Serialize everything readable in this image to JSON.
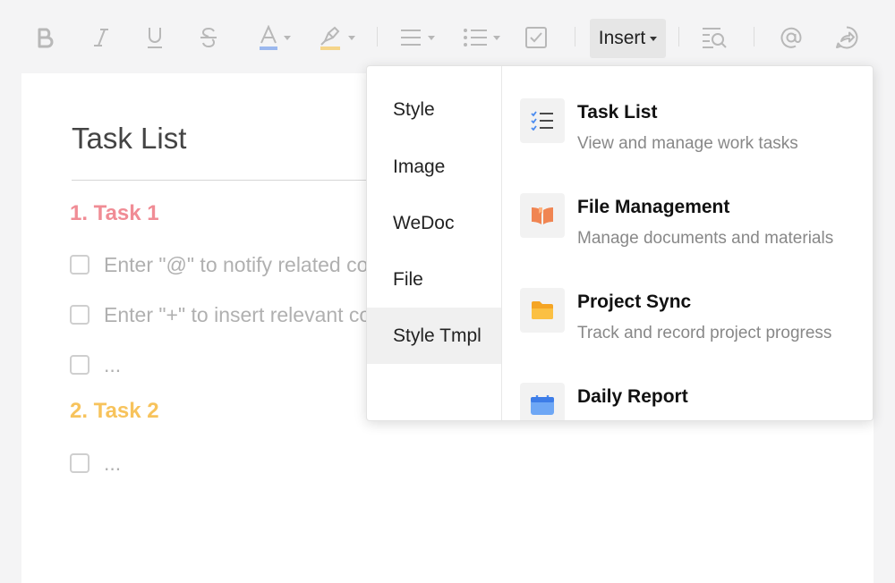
{
  "toolbar": {
    "insert_label": "Insert",
    "icons": [
      "bold-icon",
      "italic-icon",
      "underline-icon",
      "strikethrough-icon",
      "font-color-icon",
      "highlight-icon",
      "align-icon",
      "bullet-list-icon",
      "checkbox-icon",
      "find-replace-icon",
      "mention-icon",
      "share-icon"
    ],
    "font_color_accent": "#9bb8ee",
    "highlight_accent": "#f5d58a"
  },
  "document": {
    "title": "Task List",
    "sections": [
      {
        "heading": "1. Task 1",
        "color": "#f08c95",
        "items": [
          "Enter \"@\" to notify related colleagues",
          "Enter \"+\" to insert relevant content",
          "..."
        ]
      },
      {
        "heading": "2. Task 2",
        "color": "#f7c35c",
        "items": [
          "..."
        ]
      }
    ]
  },
  "insert_menu": {
    "categories": [
      "Style",
      "Image",
      "WeDoc",
      "File",
      "Style Tmpl"
    ],
    "active_category": "Style Tmpl",
    "templates": [
      {
        "title": "Task List",
        "desc": "View and manage work tasks",
        "icon": "checklist-icon"
      },
      {
        "title": "File Management",
        "desc": "Manage documents and materials",
        "icon": "book-icon"
      },
      {
        "title": "Project Sync",
        "desc": "Track and record project progress",
        "icon": "folder-icon"
      },
      {
        "title": "Daily Report",
        "desc": "",
        "icon": "calendar-icon"
      }
    ]
  }
}
